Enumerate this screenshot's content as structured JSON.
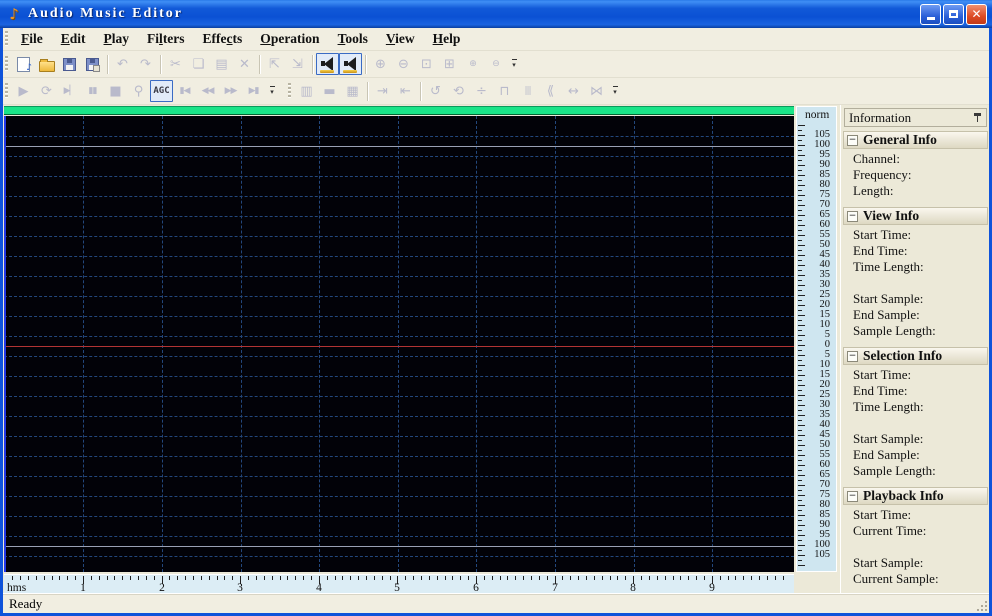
{
  "window": {
    "title": "Audio Music Editor",
    "controls": {
      "minimize": "minimize",
      "maximize": "maximize",
      "close": "✕"
    }
  },
  "menu": {
    "items": [
      {
        "label": "File",
        "u": 0
      },
      {
        "label": "Edit",
        "u": 0
      },
      {
        "label": "Play",
        "u": 0
      },
      {
        "label": "Filters",
        "u": 2
      },
      {
        "label": "Effects",
        "u": 4
      },
      {
        "label": "Operation",
        "u": 0
      },
      {
        "label": "Tools",
        "u": 0
      },
      {
        "label": "View",
        "u": 0
      },
      {
        "label": "Help",
        "u": 0
      }
    ]
  },
  "toolbars": {
    "overflow_glyph": "▾",
    "note_glyph": "♪",
    "main": [
      {
        "name": "new-file",
        "kind": "doc-note",
        "state": "enabled"
      },
      {
        "name": "open-file",
        "kind": "folder",
        "state": "enabled"
      },
      {
        "name": "save-file",
        "kind": "floppy",
        "state": "enabled"
      },
      {
        "name": "save-as",
        "kind": "floppy-badge",
        "state": "enabled"
      },
      {
        "separator": true
      },
      {
        "name": "undo",
        "glyph": "↶",
        "state": "disabled"
      },
      {
        "name": "redo",
        "glyph": "↷",
        "state": "disabled"
      },
      {
        "separator": true
      },
      {
        "name": "cut",
        "glyph": "✂",
        "state": "disabled"
      },
      {
        "name": "copy",
        "glyph": "❏",
        "state": "disabled"
      },
      {
        "name": "paste",
        "glyph": "▤",
        "state": "disabled"
      },
      {
        "name": "delete",
        "glyph": "✕",
        "state": "disabled"
      },
      {
        "separator": true
      },
      {
        "name": "select-add",
        "glyph": "⇱",
        "state": "disabled"
      },
      {
        "name": "select-special",
        "glyph": "⇲",
        "state": "disabled"
      },
      {
        "separator": true
      },
      {
        "name": "left-channel",
        "kind": "speaker",
        "state": "active"
      },
      {
        "name": "right-channel",
        "kind": "speaker",
        "state": "active"
      },
      {
        "separator": true
      },
      {
        "name": "zoom-in",
        "glyph": "⊕",
        "state": "disabled"
      },
      {
        "name": "zoom-out",
        "glyph": "⊖",
        "state": "disabled"
      },
      {
        "name": "zoom-window",
        "glyph": "⊡",
        "state": "disabled"
      },
      {
        "name": "zoom-selection",
        "glyph": "⊞",
        "state": "disabled"
      },
      {
        "name": "zoom-vertical-in",
        "glyph": "⊕",
        "state": "disabled",
        "small": true
      },
      {
        "name": "zoom-vertical-out",
        "glyph": "⊖",
        "state": "disabled",
        "small": true
      }
    ],
    "play": [
      {
        "name": "play",
        "glyph": "▶",
        "state": "disabled"
      },
      {
        "name": "play-loop",
        "glyph": "⟳",
        "state": "disabled"
      },
      {
        "name": "play-to-end",
        "glyph": "▶▏",
        "state": "disabled",
        "small": true
      },
      {
        "name": "pause",
        "glyph": "▮▮",
        "state": "disabled",
        "small": true
      },
      {
        "name": "stop",
        "glyph": "■",
        "state": "disabled"
      },
      {
        "name": "record",
        "glyph": "⚲",
        "state": "disabled"
      },
      {
        "name": "agc",
        "kind": "text",
        "label": "AGC",
        "state": "active"
      },
      {
        "name": "go-to-start",
        "glyph": "▮◀",
        "state": "disabled",
        "small": true
      },
      {
        "name": "rewind",
        "glyph": "◀◀",
        "state": "disabled",
        "small": true
      },
      {
        "name": "fast-forward",
        "glyph": "▶▶",
        "state": "disabled",
        "small": true
      },
      {
        "name": "go-to-end",
        "glyph": "▶▮",
        "state": "disabled",
        "small": true
      }
    ],
    "edit": [
      {
        "name": "stripes-dense",
        "glyph": "▥",
        "state": "disabled"
      },
      {
        "name": "stripes-fine",
        "glyph": "▬",
        "state": "disabled"
      },
      {
        "name": "stripes-grid",
        "glyph": "▦",
        "state": "disabled"
      },
      {
        "separator": true
      },
      {
        "name": "nudge-right",
        "glyph": "⇥",
        "state": "disabled"
      },
      {
        "name": "nudge-left",
        "glyph": "⇤",
        "state": "disabled"
      },
      {
        "separator": true
      },
      {
        "name": "rotate-left",
        "glyph": "↺",
        "state": "disabled"
      },
      {
        "name": "rotate-loop",
        "glyph": "⟲",
        "state": "disabled"
      },
      {
        "name": "center-align",
        "glyph": "÷",
        "state": "disabled"
      },
      {
        "name": "clamp",
        "glyph": "⊓",
        "state": "disabled"
      },
      {
        "name": "barcode",
        "glyph": "|||",
        "state": "disabled",
        "small": true
      },
      {
        "name": "fade-in",
        "glyph": "⟪",
        "state": "disabled"
      },
      {
        "name": "stretch-horizontal",
        "glyph": "↔",
        "state": "disabled"
      },
      {
        "name": "pinch",
        "glyph": "⋈",
        "state": "disabled"
      }
    ]
  },
  "wave": {
    "overview_color": "#1ae488",
    "background": "#020208",
    "grid_color": "#23477c",
    "center_line_color": "#b23434",
    "level_line_color": "#9aa0b4",
    "cursor_color": "#2238e8"
  },
  "scale": {
    "top_label": "norm",
    "labels": [
      105,
      100,
      95,
      90,
      85,
      80,
      75,
      70,
      65,
      60,
      55,
      50,
      45,
      40,
      35,
      30,
      25,
      20,
      15,
      10,
      5,
      0,
      5,
      10,
      15,
      20,
      25,
      30,
      35,
      40,
      45,
      50,
      55,
      60,
      65,
      70,
      75,
      80,
      85,
      90,
      95,
      100,
      105
    ]
  },
  "ruler": {
    "unit_label": "hms",
    "labels": [
      "1",
      "2",
      "3",
      "4",
      "5",
      "6",
      "7",
      "8",
      "9"
    ]
  },
  "info_panel": {
    "title": "Information",
    "collapse_glyph": "−",
    "sections": [
      {
        "title": "General Info",
        "items": [
          "Channel:",
          "Frequency:",
          "Length:"
        ]
      },
      {
        "title": "View Info",
        "items": [
          "Start Time:",
          "End Time:",
          "Time Length:",
          "",
          "Start Sample:",
          "End Sample:",
          "Sample Length:"
        ]
      },
      {
        "title": "Selection Info",
        "items": [
          "Start Time:",
          "End Time:",
          "Time Length:",
          "",
          "Start Sample:",
          "End Sample:",
          "Sample Length:"
        ]
      },
      {
        "title": "Playback Info",
        "items": [
          "Start Time:",
          "Current Time:",
          "",
          "Start Sample:",
          "Current Sample:"
        ]
      }
    ]
  },
  "status": {
    "text": "Ready"
  }
}
